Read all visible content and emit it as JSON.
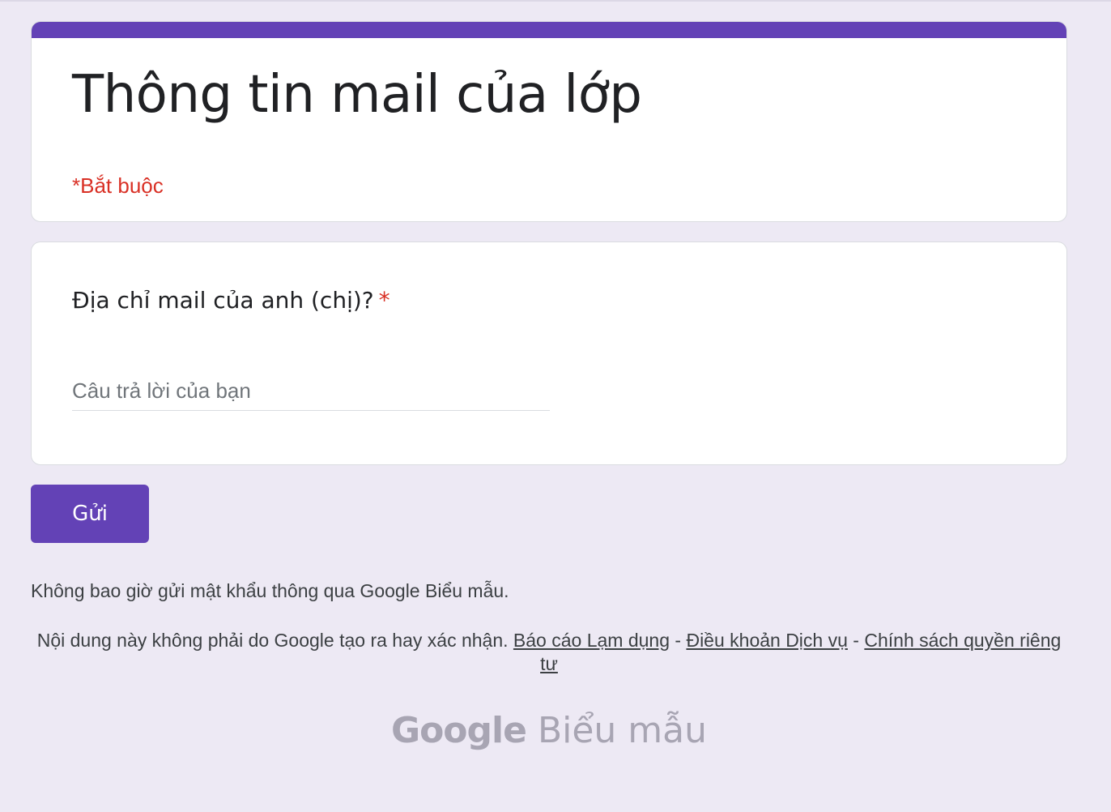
{
  "form": {
    "title": "Thông tin mail của lớp",
    "required_note": "*Bắt buộc",
    "accent_color": "#6342b6",
    "required_color": "#d93025"
  },
  "question": {
    "title": "Địa chỉ mail của anh (chị)?",
    "required_marker": "*",
    "answer_placeholder": "Câu trả lời của bạn",
    "answer_value": ""
  },
  "submit": {
    "label": "Gửi"
  },
  "footer": {
    "password_warning": "Không bao giờ gửi mật khẩu thông qua Google Biểu mẫu.",
    "disclaimer_text": "Nội dung này không phải do Google tạo ra hay xác nhận.",
    "separator": "-",
    "links": {
      "report_abuse": "Báo cáo Lạm dụng",
      "terms": "Điều khoản Dịch vụ",
      "privacy": "Chính sách quyền riêng tư"
    },
    "brand_google": "Google",
    "brand_product": "Biểu mẫu"
  }
}
